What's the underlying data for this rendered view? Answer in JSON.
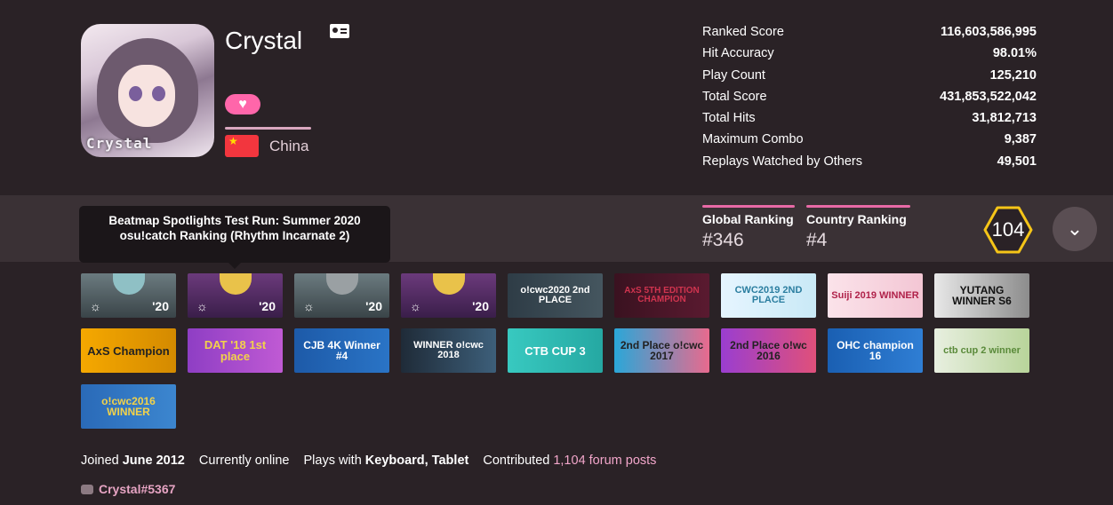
{
  "user": {
    "username": "Crystal",
    "avatar_text": "Crystal",
    "country": "China",
    "supporter_icon": "heart-icon"
  },
  "stats": [
    {
      "label": "Ranked Score",
      "value": "116,603,586,995"
    },
    {
      "label": "Hit Accuracy",
      "value": "98.01%"
    },
    {
      "label": "Play Count",
      "value": "125,210"
    },
    {
      "label": "Total Score",
      "value": "431,853,522,042"
    },
    {
      "label": "Total Hits",
      "value": "31,812,713"
    },
    {
      "label": "Maximum Combo",
      "value": "9,387"
    },
    {
      "label": "Replays Watched by Others",
      "value": "49,501"
    }
  ],
  "ranking": {
    "global_label": "Global Ranking",
    "global_value": "#346",
    "country_label": "Country Ranking",
    "country_value": "#4",
    "level": "104"
  },
  "tooltip": "Beatmap Spotlights Test Run: Summer 2020 osu!catch Ranking (Rhythm Incarnate 2)",
  "badges_row1": [
    "'20",
    "'20",
    "'20",
    "'20",
    "o!cwc2020 2nd PLACE",
    "AxS 5TH EDITION CHAMPION",
    "CWC2019 2ND PLACE",
    "Suiji 2019 WINNER",
    "YUTANG WINNER S6"
  ],
  "badges_row2": [
    "AxS Champion",
    "DAT '18 1st place",
    "CJB 4K Winner #4",
    "WINNER o!cwc 2018",
    "CTB CUP 3",
    "2nd Place o!cwc 2017",
    "2nd Place o!wc 2016",
    "OHC champion 16",
    "ctb cup 2 winner"
  ],
  "badges_row3": [
    "o!cwc2016 WINNER"
  ],
  "footer": {
    "joined_prefix": "Joined",
    "joined_date": "June 2012",
    "status": "Currently online",
    "plays_prefix": "Plays with",
    "plays_with": "Keyboard, Tablet",
    "contributed_prefix": "Contributed",
    "forum_posts": "1,104 forum posts",
    "discord": "Crystal#5367"
  },
  "colors": {
    "accent": "#e86aa6",
    "background": "#2a2226",
    "rank_bar": "#3a3135",
    "level_ring": "#f5c518"
  }
}
